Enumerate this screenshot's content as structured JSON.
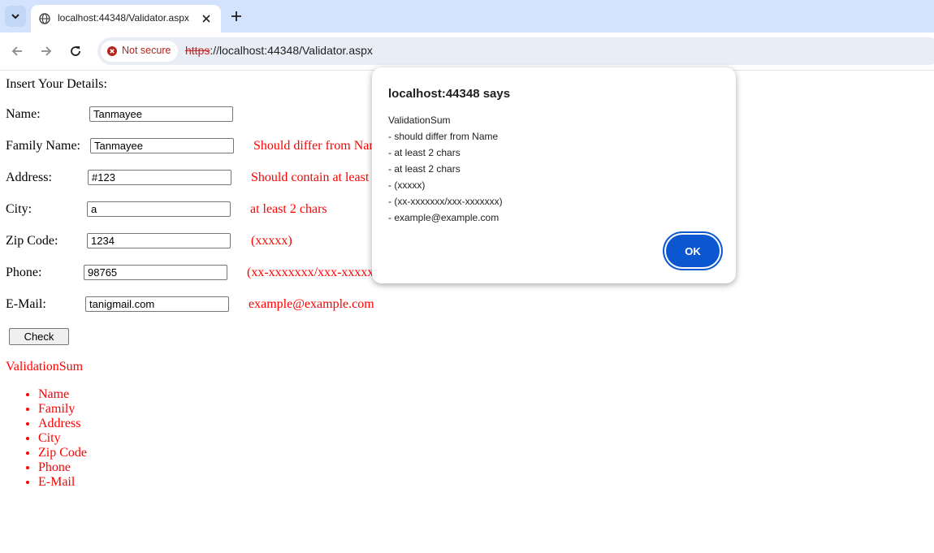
{
  "browser": {
    "tab_title": "localhost:44348/Validator.aspx",
    "security_label": "Not secure",
    "url_scheme": "https",
    "url_rest": "://localhost:44348/Validator.aspx"
  },
  "page": {
    "heading": "Insert Your Details:",
    "fields": {
      "name": {
        "label": "Name:",
        "value": "Tanmayee"
      },
      "family": {
        "label": "Family Name:",
        "value": "Tanmayee",
        "error": "Should differ from Name"
      },
      "address": {
        "label": "Address:",
        "value": "#123",
        "error": "Should contain at least 2 chars"
      },
      "city": {
        "label": "City:",
        "value": "a",
        "error": "at least 2 chars"
      },
      "zip": {
        "label": "Zip Code:",
        "value": "1234",
        "error": "(xxxxx)"
      },
      "phone": {
        "label": "Phone:",
        "value": "98765",
        "error": "(xx-xxxxxxx/xxx-xxxxxxx)"
      },
      "email": {
        "label": "E-Mail:",
        "value": "tanigmail.com",
        "error": "example@example.com"
      }
    },
    "check_button": "Check",
    "summary_title": "ValidationSum",
    "summary_items": [
      "Name",
      "Family",
      "Address",
      "City",
      "Zip Code",
      "Phone",
      "E-Mail"
    ]
  },
  "dialog": {
    "title": "localhost:44348 says",
    "lines": [
      "ValidationSum",
      "- should differ from Name",
      "- at least 2 chars",
      "- at least 2 chars",
      "- (xxxxx)",
      "- (xx-xxxxxxx/xxx-xxxxxxx)",
      "- example@example.com"
    ],
    "ok_label": "OK"
  }
}
